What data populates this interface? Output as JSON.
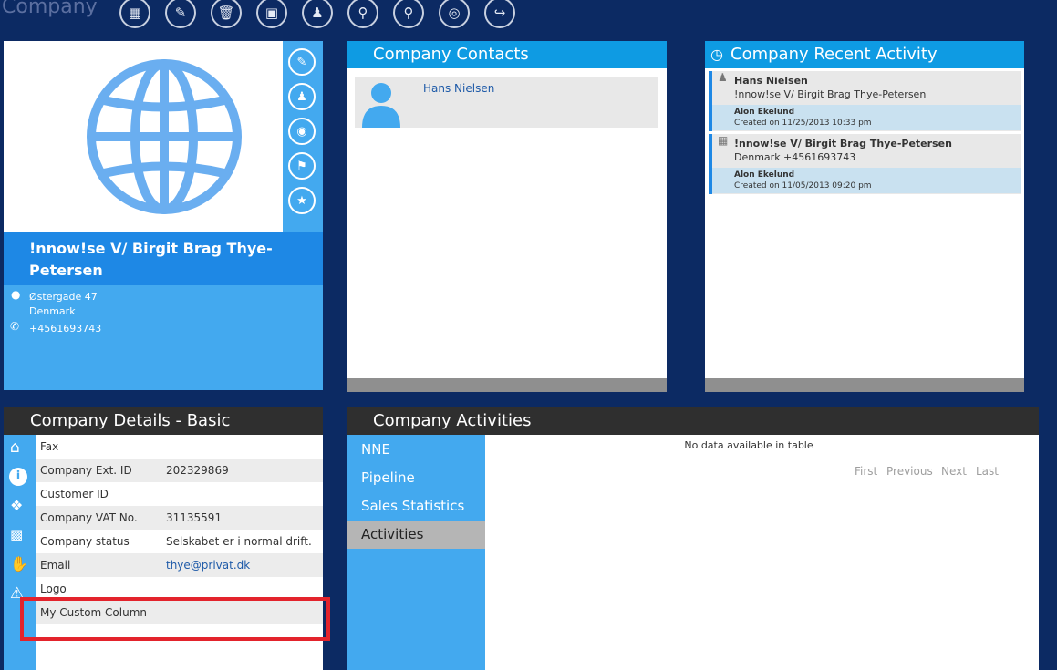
{
  "app": {
    "title": "Company"
  },
  "toolbar": {
    "buttons": [
      {
        "name": "new-company-button",
        "icon": "building-plus-icon"
      },
      {
        "name": "edit-company-button",
        "icon": "building-edit-icon"
      },
      {
        "name": "delete-button",
        "icon": "trash-icon"
      },
      {
        "name": "add-activity-button",
        "icon": "calendar-plus-icon"
      },
      {
        "name": "add-contact-button",
        "icon": "person-plus-icon"
      },
      {
        "name": "search-settings-button",
        "icon": "magnify-gear-icon"
      },
      {
        "name": "search-clear-button",
        "icon": "magnify-x-icon"
      },
      {
        "name": "web-button",
        "icon": "globe-icon"
      },
      {
        "name": "export-button",
        "icon": "table-export-icon"
      }
    ]
  },
  "profile": {
    "name": "!nnow!se V/ Birgit Brag Thye-Petersen",
    "address_line1": "Østergade 47",
    "address_line2": "Denmark",
    "phone": "+4561693743"
  },
  "contacts": {
    "title": "Company Contacts",
    "items": [
      {
        "name": "Hans Nielsen"
      }
    ]
  },
  "activity": {
    "title": "Company Recent Activity",
    "items": [
      {
        "title": "Hans Nielsen",
        "subtitle": "!nnow!se V/ Birgit Brag Thye-Petersen",
        "author": "Alon Ekelund",
        "created": "Created on 11/25/2013 10:33 pm"
      },
      {
        "title": "!nnow!se V/ Birgit Brag Thye-Petersen",
        "subtitle": "Denmark +4561693743",
        "author": "Alon Ekelund",
        "created": "Created on 11/05/2013 09:20 pm"
      }
    ]
  },
  "details": {
    "title": "Company Details - Basic",
    "rows": [
      {
        "label": "Fax",
        "value": ""
      },
      {
        "label": "Company Ext. ID",
        "value": "202329869"
      },
      {
        "label": "Customer ID",
        "value": ""
      },
      {
        "label": "Company VAT No.",
        "value": "31135591"
      },
      {
        "label": "Company status",
        "value": "Selskabet er i normal drift."
      },
      {
        "label": "Email",
        "value": "thye@privat.dk"
      },
      {
        "label": "Logo",
        "value": ""
      },
      {
        "label": "My Custom Column",
        "value": ""
      }
    ]
  },
  "activities": {
    "title": "Company Activities",
    "tabs": [
      {
        "label": "NNE"
      },
      {
        "label": "Pipeline"
      },
      {
        "label": "Sales Statistics"
      },
      {
        "label": "Activities",
        "selected": true
      }
    ],
    "empty_text": "No data available in table",
    "pager": {
      "first": "First",
      "previous": "Previous",
      "next": "Next",
      "last": "Last"
    }
  },
  "colors": {
    "accent": "#43a9ef",
    "header_dark": "#2f2f2f",
    "highlight": "#e3232c"
  }
}
